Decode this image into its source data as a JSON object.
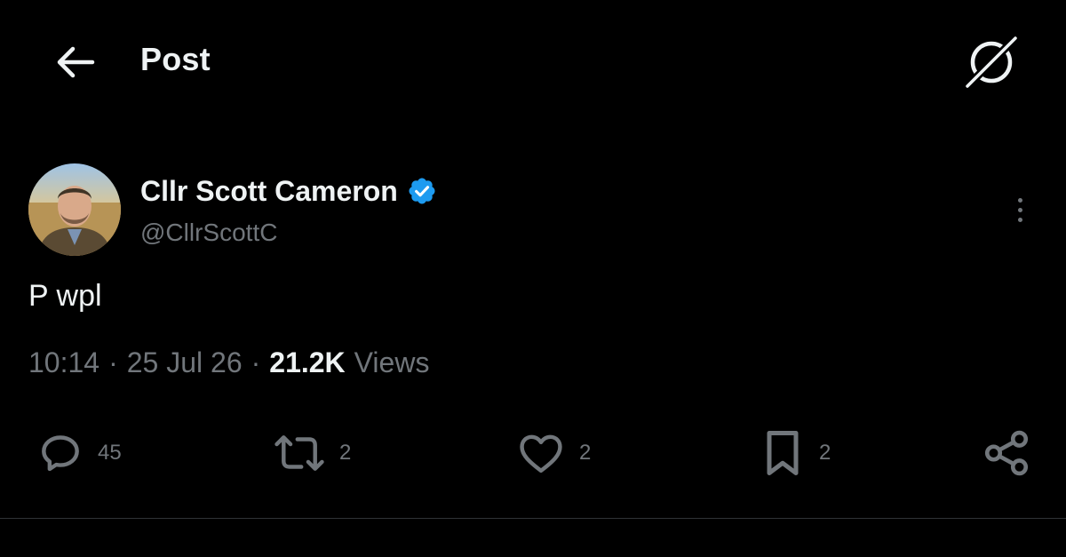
{
  "header": {
    "title": "Post",
    "back_icon": "arrow-left-icon",
    "grok_icon": "grok-slash-circle-icon"
  },
  "author": {
    "display_name": "Cllr Scott Cameron",
    "handle": "@CllrScottC",
    "verified": true,
    "verified_color": "#1d9bf0"
  },
  "post": {
    "text": "P wpl",
    "time": "10:14",
    "date": "25 Jul 26",
    "separator": "·",
    "views_count": "21.2K",
    "views_label": "Views"
  },
  "actions": {
    "replies": "45",
    "reposts": "2",
    "likes": "2",
    "bookmarks": "2"
  },
  "colors": {
    "background": "#000000",
    "text_primary": "#eff3f4",
    "text_secondary": "#71767b",
    "divider": "#2f3336"
  }
}
